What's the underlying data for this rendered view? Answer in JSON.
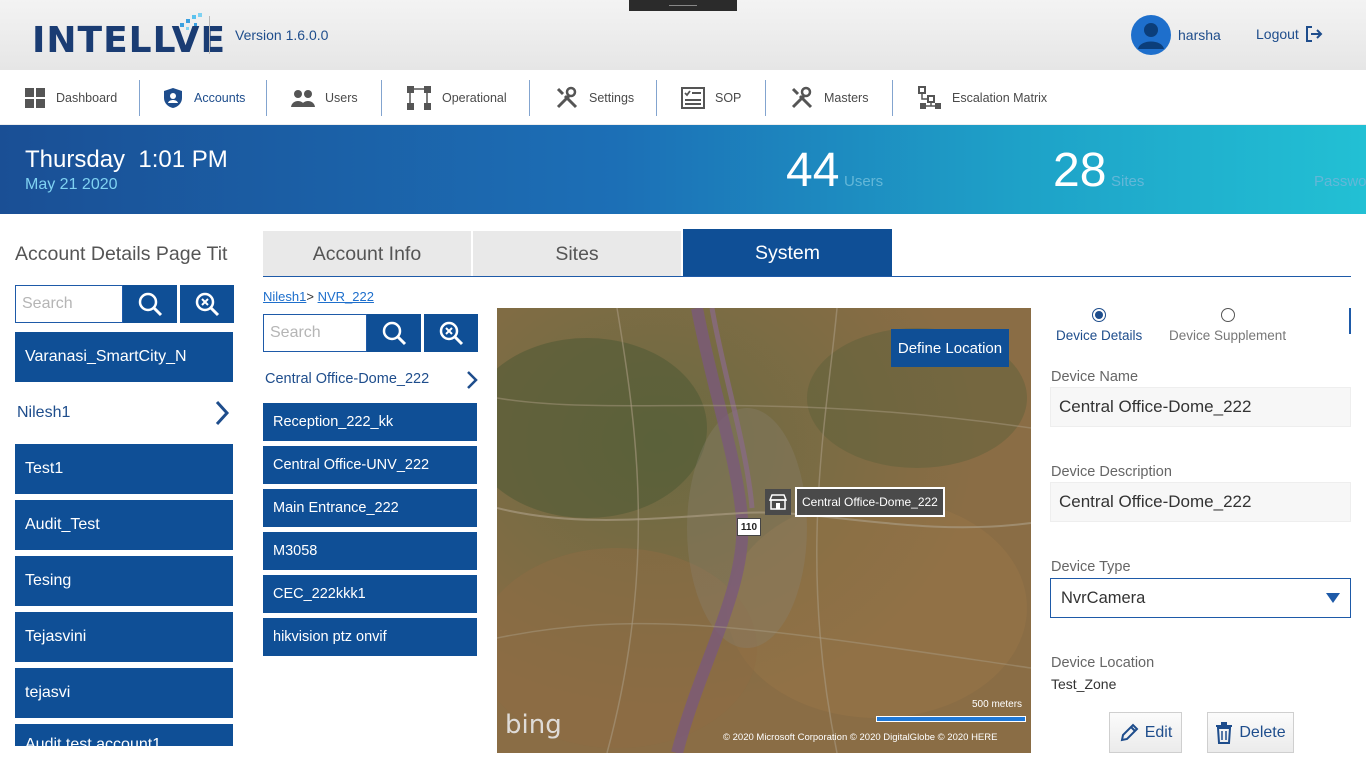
{
  "header": {
    "logo_text": "INTELLVE",
    "version": "Version 1.6.0.0",
    "username": "harsha",
    "logout_label": "Logout"
  },
  "nav": {
    "items": [
      {
        "label": "Dashboard",
        "icon": "grid-icon"
      },
      {
        "label": "Accounts",
        "icon": "shield-user-icon",
        "active": true
      },
      {
        "label": "Users",
        "icon": "users-icon"
      },
      {
        "label": "Operational",
        "icon": "flow-icon"
      },
      {
        "label": "Settings",
        "icon": "tools-icon"
      },
      {
        "label": "SOP",
        "icon": "checklist-icon"
      },
      {
        "label": "Masters",
        "icon": "tools-icon"
      },
      {
        "label": "Escalation Matrix",
        "icon": "hierarchy-icon"
      }
    ]
  },
  "banner": {
    "day": "Thursday",
    "time": "1:01 PM",
    "date": "May 21 2020",
    "users_count": "44",
    "users_label": "Users",
    "sites_count": "28",
    "sites_label": "Sites",
    "password_label": "Passwo"
  },
  "accounts": {
    "title": "Account Details Page Tit",
    "search_placeholder": "Search",
    "items": [
      "Varanasi_SmartCity_N",
      "Nilesh1",
      "Test1",
      "Audit_Test",
      "Tesing",
      "Tejasvini",
      "tejasvi",
      "Audit test account1"
    ],
    "selected": "Nilesh1"
  },
  "tabs": {
    "account_info": "Account Info",
    "sites": "Sites",
    "system": "System"
  },
  "breadcrumb": {
    "root": "Nilesh1",
    "separator": ">",
    "leaf": "NVR_222"
  },
  "devices": {
    "search_placeholder": "Search",
    "selected": "Central Office-Dome_222",
    "items": [
      "Reception_222_kk",
      "Central Office-UNV_222",
      "Main Entrance_222",
      "M3058",
      "CEC_222kkk1",
      "hikvision ptz onvif"
    ]
  },
  "map": {
    "define_location_label": "Define Location",
    "pin_label": "Central Office-Dome_222",
    "road_number": "110",
    "brand": "bing",
    "scale_label": "500 meters",
    "copyright": "© 2020 Microsoft Corporation   © 2020 DigitalGlobe   © 2020 HERE"
  },
  "details": {
    "radio_device_details": "Device Details",
    "radio_device_supplement": "Device Supplement",
    "device_name_label": "Device Name",
    "device_name_value": "Central Office-Dome_222",
    "device_description_label": "Device Description",
    "device_description_value": "Central Office-Dome_222",
    "device_type_label": "Device Type",
    "device_type_value": "NvrCamera",
    "device_location_label": "Device Location",
    "device_location_value": "Test_Zone",
    "edit_label": "Edit",
    "delete_label": "Delete"
  },
  "colors": {
    "primary": "#0f4f96",
    "accent_text": "#1e4d8c",
    "banner_start": "#1a4f95",
    "banner_end": "#22c0d4"
  }
}
